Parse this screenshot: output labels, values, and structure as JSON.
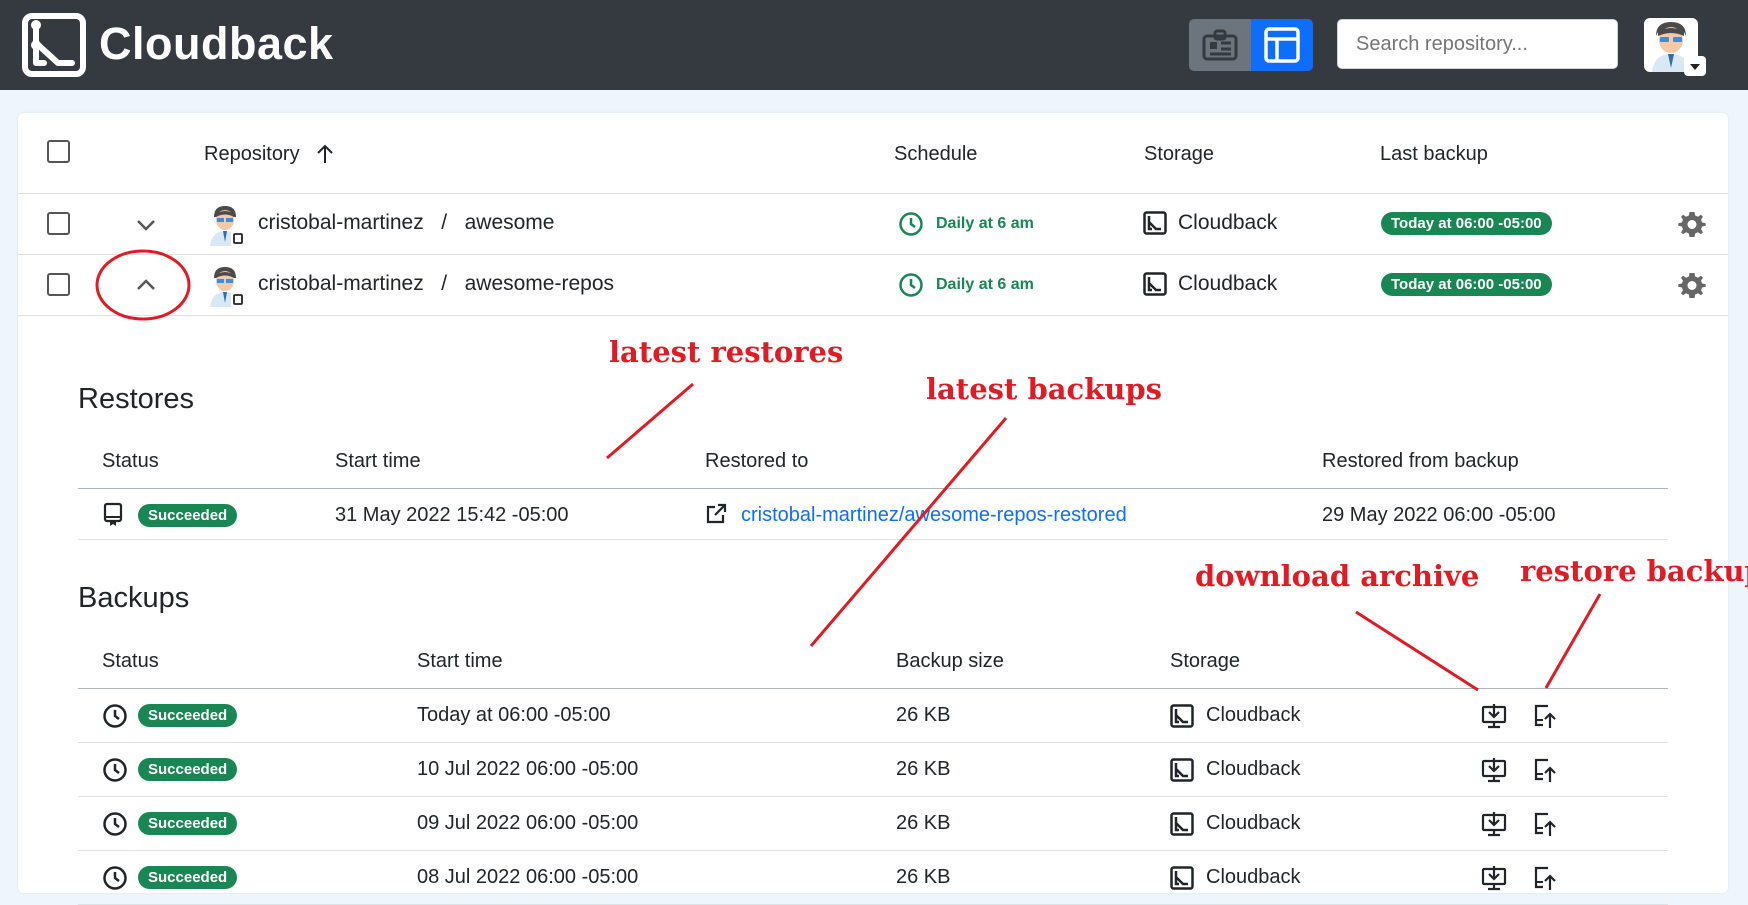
{
  "app": {
    "name": "Cloudback"
  },
  "search": {
    "placeholder": "Search repository..."
  },
  "table": {
    "headers": {
      "repository": "Repository",
      "schedule": "Schedule",
      "storage": "Storage",
      "last_backup": "Last backup"
    },
    "rows": [
      {
        "owner": "cristobal-martinez",
        "sep": "/",
        "repo": "awesome",
        "schedule": "Daily at 6 am",
        "storage": "Cloudback",
        "last_backup": "Today at 06:00 -05:00",
        "expanded": false
      },
      {
        "owner": "cristobal-martinez",
        "sep": "/",
        "repo": "awesome-repos",
        "schedule": "Daily at 6 am",
        "storage": "Cloudback",
        "last_backup": "Today at 06:00 -05:00",
        "expanded": true
      }
    ]
  },
  "restores": {
    "title": "Restores",
    "headers": {
      "status": "Status",
      "start_time": "Start time",
      "restored_to": "Restored to",
      "restored_from": "Restored from backup"
    },
    "rows": [
      {
        "status": "Succeeded",
        "start_time": "31 May 2022 15:42 -05:00",
        "restored_to": "cristobal-martinez/awesome-repos-restored",
        "restored_from": "29 May 2022 06:00 -05:00"
      }
    ]
  },
  "backups": {
    "title": "Backups",
    "headers": {
      "status": "Status",
      "start_time": "Start time",
      "size": "Backup size",
      "storage": "Storage"
    },
    "rows": [
      {
        "status": "Succeeded",
        "start_time": "Today at 06:00 -05:00",
        "size": "26 KB",
        "storage": "Cloudback"
      },
      {
        "status": "Succeeded",
        "start_time": "10 Jul 2022 06:00 -05:00",
        "size": "26 KB",
        "storage": "Cloudback"
      },
      {
        "status": "Succeeded",
        "start_time": "09 Jul 2022 06:00 -05:00",
        "size": "26 KB",
        "storage": "Cloudback"
      },
      {
        "status": "Succeeded",
        "start_time": "08 Jul 2022 06:00 -05:00",
        "size": "26 KB",
        "storage": "Cloudback"
      }
    ]
  },
  "annotations": {
    "latest_restores": "latest restores",
    "latest_backups": "latest backups",
    "download_archive": "download archive",
    "restore_backup": "restore backup",
    "color": "#e01b24"
  },
  "colors": {
    "success": "#198754",
    "topbar": "#343a40",
    "primary": "#0d6efd"
  }
}
